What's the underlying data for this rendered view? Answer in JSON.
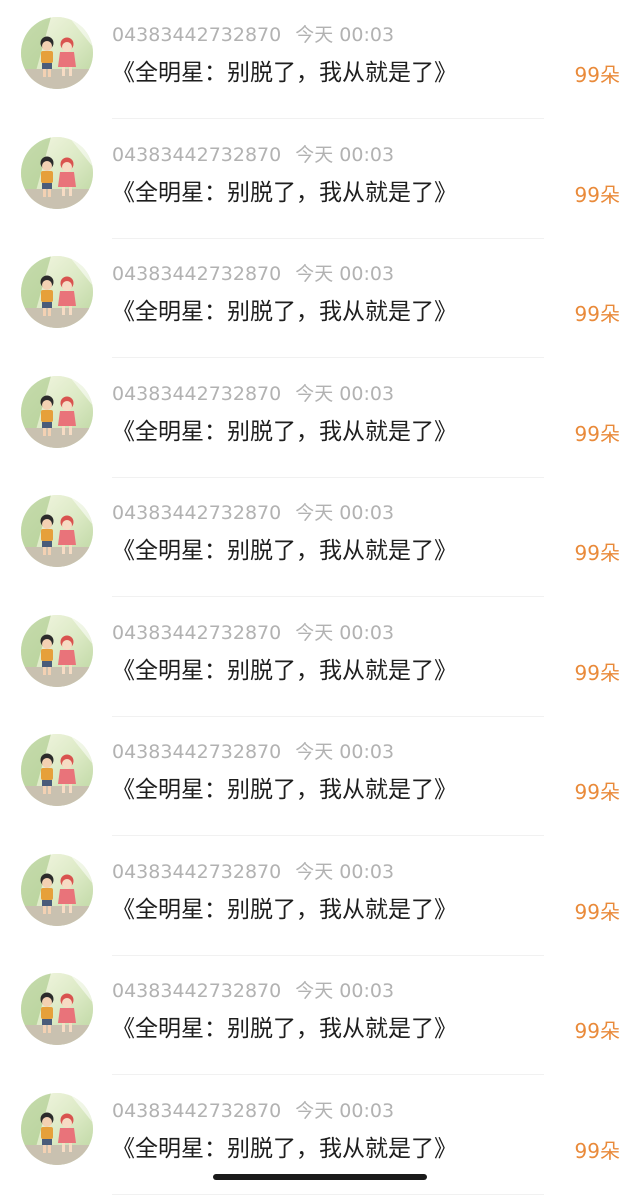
{
  "list": {
    "items": [
      {
        "user_id": "04383442732870",
        "time": "今天 00:03",
        "title": "《全明星：别脱了，我从就是了》",
        "flowers": "99朵"
      },
      {
        "user_id": "04383442732870",
        "time": "今天 00:03",
        "title": "《全明星：别脱了，我从就是了》",
        "flowers": "99朵"
      },
      {
        "user_id": "04383442732870",
        "time": "今天 00:03",
        "title": "《全明星：别脱了，我从就是了》",
        "flowers": "99朵"
      },
      {
        "user_id": "04383442732870",
        "time": "今天 00:03",
        "title": "《全明星：别脱了，我从就是了》",
        "flowers": "99朵"
      },
      {
        "user_id": "04383442732870",
        "time": "今天 00:03",
        "title": "《全明星：别脱了，我从就是了》",
        "flowers": "99朵"
      },
      {
        "user_id": "04383442732870",
        "time": "今天 00:03",
        "title": "《全明星：别脱了，我从就是了》",
        "flowers": "99朵"
      },
      {
        "user_id": "04383442732870",
        "time": "今天 00:03",
        "title": "《全明星：别脱了，我从就是了》",
        "flowers": "99朵"
      },
      {
        "user_id": "04383442732870",
        "time": "今天 00:03",
        "title": "《全明星：别脱了，我从就是了》",
        "flowers": "99朵"
      },
      {
        "user_id": "04383442732870",
        "time": "今天 00:03",
        "title": "《全明星：别脱了，我从就是了》",
        "flowers": "99朵"
      },
      {
        "user_id": "04383442732870",
        "time": "今天 00:03",
        "title": "《全明星：别脱了，我从就是了》",
        "flowers": "99朵"
      }
    ]
  },
  "colors": {
    "meta_text": "#b2b2b2",
    "title_text": "#1e1e1e",
    "flower_count": "#e98a3a",
    "divider": "#f1f1f1",
    "home_indicator": "#1a1a1a"
  },
  "icons": {
    "avatar": "cartoon-children-avatar"
  }
}
